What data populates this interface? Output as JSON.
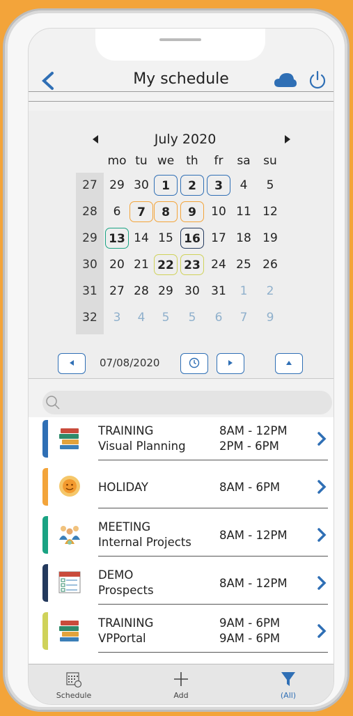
{
  "header": {
    "title": "My schedule"
  },
  "calendar": {
    "month_label": "July 2020",
    "weekdays": [
      "mo",
      "tu",
      "we",
      "th",
      "fr",
      "sa",
      "su"
    ],
    "weeks": [
      {
        "wk": "27",
        "days": [
          "29",
          "30",
          "1",
          "2",
          "3",
          "4",
          "5"
        ]
      },
      {
        "wk": "28",
        "days": [
          "6",
          "7",
          "8",
          "9",
          "10",
          "11",
          "12"
        ]
      },
      {
        "wk": "29",
        "days": [
          "13",
          "14",
          "15",
          "16",
          "17",
          "18",
          "19"
        ]
      },
      {
        "wk": "30",
        "days": [
          "20",
          "21",
          "22",
          "23",
          "24",
          "25",
          "26"
        ]
      },
      {
        "wk": "31",
        "days": [
          "27",
          "28",
          "29",
          "30",
          "31",
          "1",
          "2"
        ]
      },
      {
        "wk": "32",
        "days": [
          "3",
          "4",
          "5",
          "5",
          "6",
          "7",
          "9"
        ]
      }
    ],
    "selected_date": "07/08/2020"
  },
  "search": {
    "placeholder": ""
  },
  "events": [
    {
      "category": "TRAINING",
      "subtitle": "Visual Planning",
      "time1": "8AM - 12PM",
      "time2": "2PM - 6PM",
      "color": "#2f6fb5",
      "icon": "books-icon"
    },
    {
      "category": "HOLIDAY",
      "subtitle": "",
      "time1": "8AM - 6PM",
      "time2": "",
      "color": "#f3a43a",
      "icon": "sun-icon"
    },
    {
      "category": "MEETING",
      "subtitle": "Internal Projects",
      "time1": "8AM - 12PM",
      "time2": "",
      "color": "#1aa383",
      "icon": "people-icon"
    },
    {
      "category": "DEMO",
      "subtitle": "Prospects",
      "time1": "8AM - 12PM",
      "time2": "",
      "color": "#23395d",
      "icon": "checklist-icon"
    },
    {
      "category": "TRAINING",
      "subtitle": "VPPortal",
      "time1": "9AM - 6PM",
      "time2": "9AM - 6PM",
      "color": "#cfd25a",
      "icon": "books-icon"
    }
  ],
  "tabs": {
    "schedule": "Schedule",
    "add": "Add",
    "filter": "(All)"
  },
  "colors": {
    "accent": "#2f6fb5",
    "muted_day": "#8fb0cc"
  }
}
